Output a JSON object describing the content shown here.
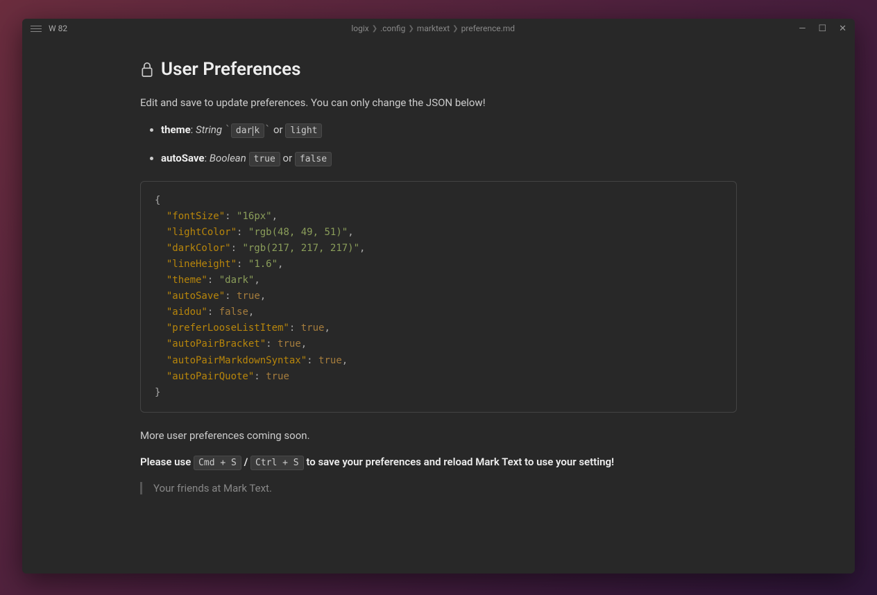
{
  "titlebar": {
    "word_count": "W 82",
    "breadcrumb": [
      "logix",
      ".config",
      "marktext",
      "preference.md"
    ]
  },
  "page": {
    "title": "User Preferences",
    "intro": "Edit and save to update preferences. You can only change the JSON below!",
    "options": [
      {
        "name": "theme",
        "type": "String",
        "val1": "dark",
        "sep": "or",
        "val2": "light",
        "tick": true
      },
      {
        "name": "autoSave",
        "type": "Boolean",
        "val1": "true",
        "sep": "or",
        "val2": "false",
        "tick": false
      }
    ],
    "json_config": {
      "fontSize": "16px",
      "lightColor": "rgb(48, 49, 51)",
      "darkColor": "rgb(217, 217, 217)",
      "lineHeight": "1.6",
      "theme": "dark",
      "autoSave": true,
      "aidou": false,
      "preferLooseListItem": true,
      "autoPairBracket": true,
      "autoPairMarkdownSyntax": true,
      "autoPairQuote": true
    },
    "coming_soon": "More user preferences coming soon.",
    "save_prefix": "Please use ",
    "save_cmd1": "Cmd + S",
    "save_slash": " / ",
    "save_cmd2": "Ctrl + S",
    "save_suffix": " to save your preferences and reload Mark Text to use your setting!",
    "signature": "Your friends at Mark Text."
  }
}
